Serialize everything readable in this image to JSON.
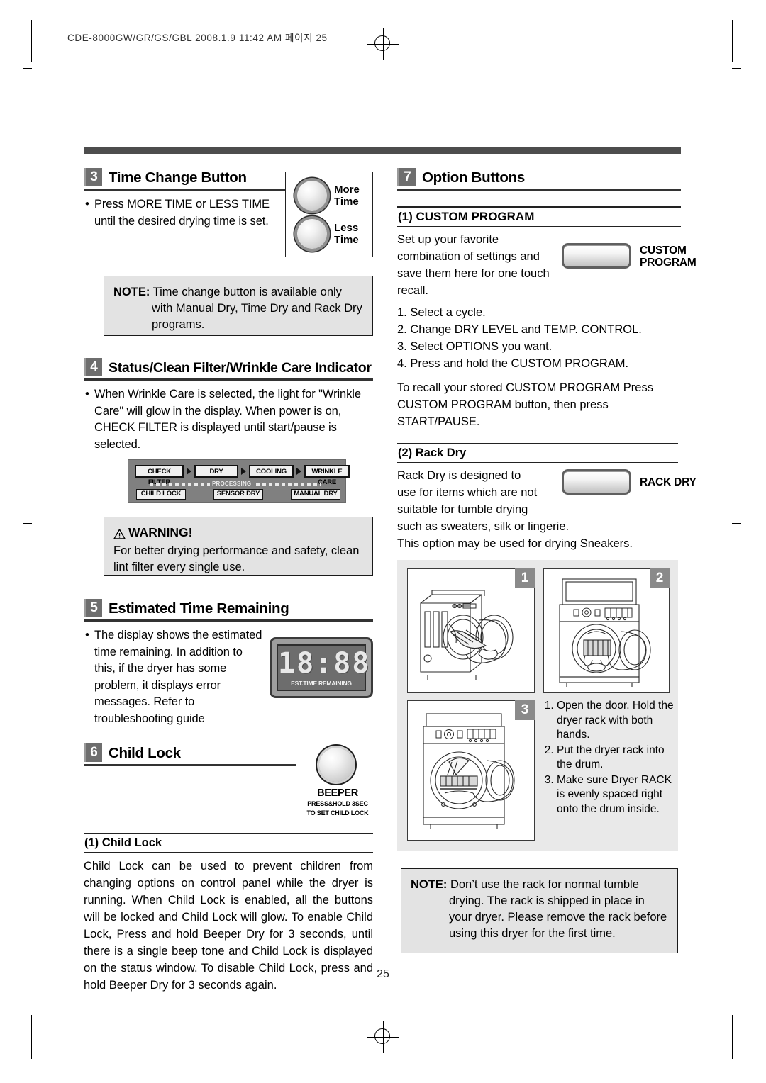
{
  "print_slug": "CDE-8000GW/GR/GS/GBL  2008.1.9 11:42 AM  페이지 25",
  "page_number": "25",
  "left_column": {
    "section3": {
      "number": "3",
      "title": "Time Change Button",
      "bullet": "Press MORE TIME or LESS TIME until the desired drying time is set.",
      "buttons": [
        {
          "label_line1": "More",
          "label_line2": "Time"
        },
        {
          "label_line1": "Less",
          "label_line2": "Time"
        }
      ],
      "note": {
        "label": "NOTE:",
        "text": "Time change button is available only with Manual Dry, Time Dry and Rack Dry programs."
      }
    },
    "section4": {
      "number": "4",
      "title": "Status/Clean Filter/Wrinkle Care Indicator",
      "bullet": "When Wrinkle Care is selected, the light for \"Wrinkle Care\" will glow in the display. When power is on, CHECK FILTER is displayed until start/pause is selected.",
      "indicator": {
        "top_cells": [
          "CHECK FILTER",
          "DRY",
          "COOLING",
          "WRINKLE CARE"
        ],
        "processing_label": "PROCESSING",
        "bottom_cells": [
          "CHILD LOCK",
          "SENSOR DRY",
          "MANUAL DRY"
        ]
      },
      "warning": {
        "title": "WARNING!",
        "text": "For better drying performance and safety, clean lint filter every single use."
      }
    },
    "section5": {
      "number": "5",
      "title": "Estimated Time Remaining",
      "bullet": "The display shows the estimated time remaining. In addition to this, if the dryer has some problem, it displays error messages. Refer to troubleshooting guide",
      "display": {
        "digits": "18:88",
        "caption": "EST.TIME REMAINING"
      }
    },
    "section6": {
      "number": "6",
      "title": "Child Lock",
      "knob": {
        "name": "BEEPER",
        "sub1": "PRESS&HOLD  3SEC",
        "sub2": "TO SET CHILD LOCK"
      },
      "sub_title": "(1) Child Lock",
      "paragraph": "Child Lock can be used to prevent children from changing options on control panel while the dryer is running. When Child Lock is enabled, all the buttons will be locked and Child Lock will glow. To enable Child Lock, Press and hold Beeper Dry for 3 seconds, until there is a single beep tone and Child Lock is displayed on the status window. To disable Child Lock, press and hold Beeper Dry for 3 seconds again."
    }
  },
  "right_column": {
    "section7": {
      "number": "7",
      "title": "Option Buttons",
      "custom_program": {
        "sub_title": "(1) CUSTOM PROGRAM",
        "intro": "Set up your favorite combination of settings and save them here for one touch recall.",
        "button_label_line1": "CUSTOM",
        "button_label_line2": "PROGRAM",
        "steps": [
          "1. Select a cycle.",
          "2. Change DRY LEVEL and TEMP. CONTROL.",
          "3. Select OPTIONS you want.",
          "4. Press and hold the CUSTOM PROGRAM."
        ],
        "recall": "To recall your stored CUSTOM PROGRAM Press CUSTOM PROGRAM button, then press START/PAUSE."
      },
      "rack_dry": {
        "sub_title": "(2) Rack Dry",
        "text_lines": [
          "Rack Dry is designed to",
          "use for items which are not",
          "suitable for tumble drying",
          "such as sweaters, silk or lingerie.",
          "This option may be used for drying Sneakers."
        ],
        "button_label": "RACK  DRY",
        "panels": [
          {
            "number": "1",
            "alt": "dryer-with-rack-angled-view"
          },
          {
            "number": "2",
            "alt": "dryer-front-rack-inserted"
          },
          {
            "number": "3",
            "alt": "dryer-front-rack-seated"
          }
        ],
        "steps": [
          "Open the door. Hold the dryer rack with both hands.",
          "Put the dryer rack into the drum.",
          "Make sure Dryer RACK is evenly spaced right onto the drum inside."
        ],
        "note": {
          "label": "NOTE:",
          "text": "Don’t use the rack for normal tumble drying. The rack is shipped in place in your dryer.  Please remove the rack before using this dryer for the first time."
        }
      }
    }
  }
}
